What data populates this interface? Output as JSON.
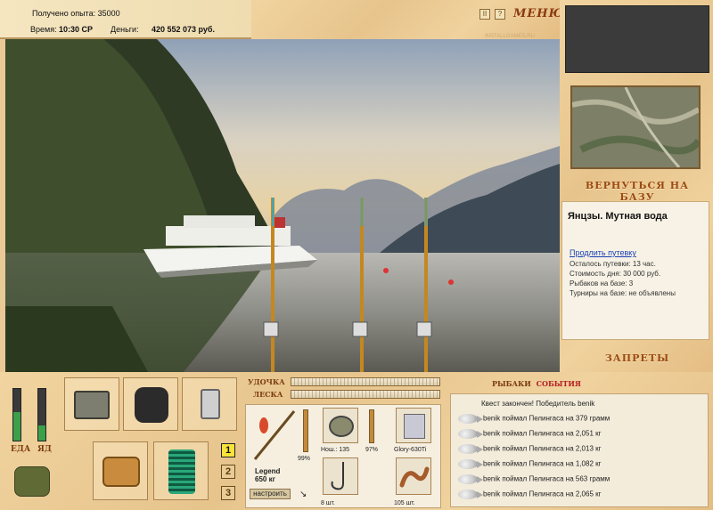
{
  "top": {
    "experience_label": "Получено опыта:",
    "experience_value": "35000",
    "time_label": "Время:",
    "time_value": "10:30 СР",
    "money_label": "Деньги:",
    "money_value": "420 552 073 руб."
  },
  "titlebar": {
    "pause_label": "II",
    "help_label": "?",
    "menu_label": "МЕНЮ",
    "watermark": "INSTALLGAMES.RU"
  },
  "right": {
    "return_base_label": "ВЕРНУТЬСЯ НА БАЗУ",
    "location_title": "Янцзы. Мутная вода",
    "extend_link": "Продлить путевку",
    "lines": [
      "Осталось путевки: 13 час.",
      "Стоимость дня: 30 000 руб.",
      "Рыбаков на базе: 3",
      "Турниры на базе: не объявлены"
    ],
    "bans_label": "ЗАПРЕТЫ"
  },
  "left_panel": {
    "food_label": "ЕДА",
    "bait_label": "ЯД",
    "food_level": 0.55,
    "bait_level": 0.3
  },
  "tabs": [
    "1",
    "2",
    "3"
  ],
  "active_tab": "1",
  "gear": {
    "rod_label": "УДОЧКА",
    "line_label": "ЛЕСКА",
    "rod_name": "Legend",
    "rod_weight": "650 кг",
    "rod_condition": "99%",
    "reel_label": "Нош.: 135",
    "reel_condition": "97%",
    "line_name": "Glory-630Ti",
    "hook_count": "8 шт.",
    "bait_count": "105 шт.",
    "configure_label": "настроить"
  },
  "events": {
    "header_left": "РЫБАКИ",
    "header_right": "СОБЫТИЯ",
    "quest_line": "Квест закончен! Победитель benik",
    "items": [
      "benik поймал Пелингаса на 379 грамм",
      "benik поймал Пелингаса на 2,051 кг",
      "benik поймал Пелингаса на 2,013 кг",
      "benik поймал Пелингаса на 1,082 кг",
      "benik поймал Пелингаса на 563 грамм",
      "benik поймал Пелингаса на 2,065 кг"
    ]
  }
}
